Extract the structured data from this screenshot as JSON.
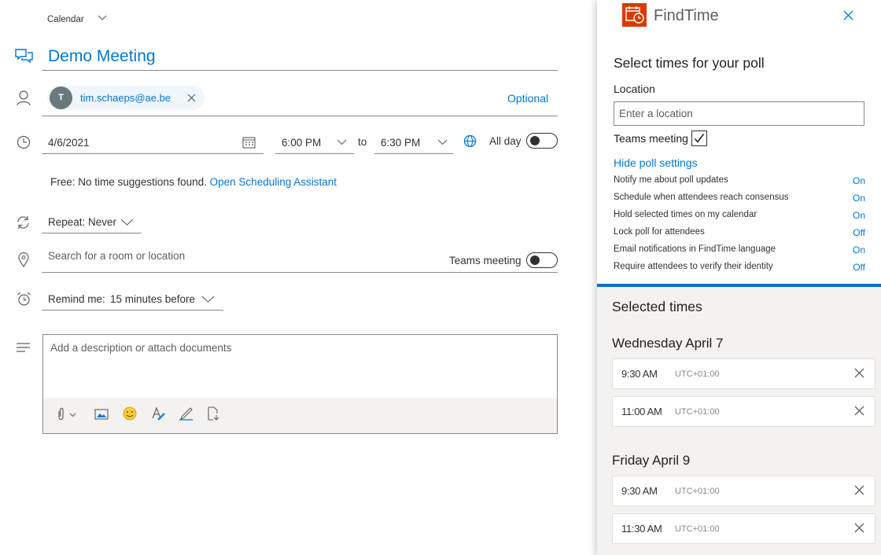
{
  "header": {
    "calendar_label": "Calendar"
  },
  "event": {
    "title": "Demo Meeting",
    "attendee": {
      "initial": "T",
      "email": "tim.schaeps@ae.be"
    },
    "optional_label": "Optional",
    "start_date": "4/6/2021",
    "start_time": "6:00 PM",
    "to_label": "to",
    "end_time": "6:30 PM",
    "all_day_label": "All day",
    "free_label": "Free:",
    "no_suggestions": "No time suggestions found.",
    "scheduling_link": "Open Scheduling Assistant",
    "repeat_label": "Repeat:",
    "repeat_value": "Never",
    "location_placeholder": "Search for a room or location",
    "teams_meeting_label": "Teams meeting",
    "remind_label": "Remind me:",
    "remind_value": "15 minutes before",
    "description_placeholder": "Add a description or attach documents"
  },
  "findtime": {
    "app_name": "FindTime",
    "heading": "Select times for your poll",
    "location_label": "Location",
    "location_placeholder": "Enter a location",
    "teams_meeting_label": "Teams meeting",
    "hide_settings_link": "Hide poll settings",
    "settings": [
      {
        "label": "Notify me about poll updates",
        "value": "On"
      },
      {
        "label": "Schedule when attendees reach consensus",
        "value": "On"
      },
      {
        "label": "Hold selected times on my calendar",
        "value": "On"
      },
      {
        "label": "Lock poll for attendees",
        "value": "Off"
      },
      {
        "label": "Email notifications in FindTime language",
        "value": "On"
      },
      {
        "label": "Require attendees to verify their identity",
        "value": "Off"
      }
    ],
    "selected_times_heading": "Selected times",
    "days": [
      {
        "label": "Wednesday April 7",
        "times": [
          {
            "time": "9:30 AM",
            "tz": "UTC+01:00"
          },
          {
            "time": "11:00 AM",
            "tz": "UTC+01:00"
          }
        ]
      },
      {
        "label": "Friday April 9",
        "times": [
          {
            "time": "9:30 AM",
            "tz": "UTC+01:00"
          },
          {
            "time": "11:30 AM",
            "tz": "UTC+01:00"
          }
        ]
      }
    ]
  },
  "colors": {
    "accent": "#0078d4",
    "brand_findtime": "#d83b01",
    "avatar": "#69797e"
  }
}
